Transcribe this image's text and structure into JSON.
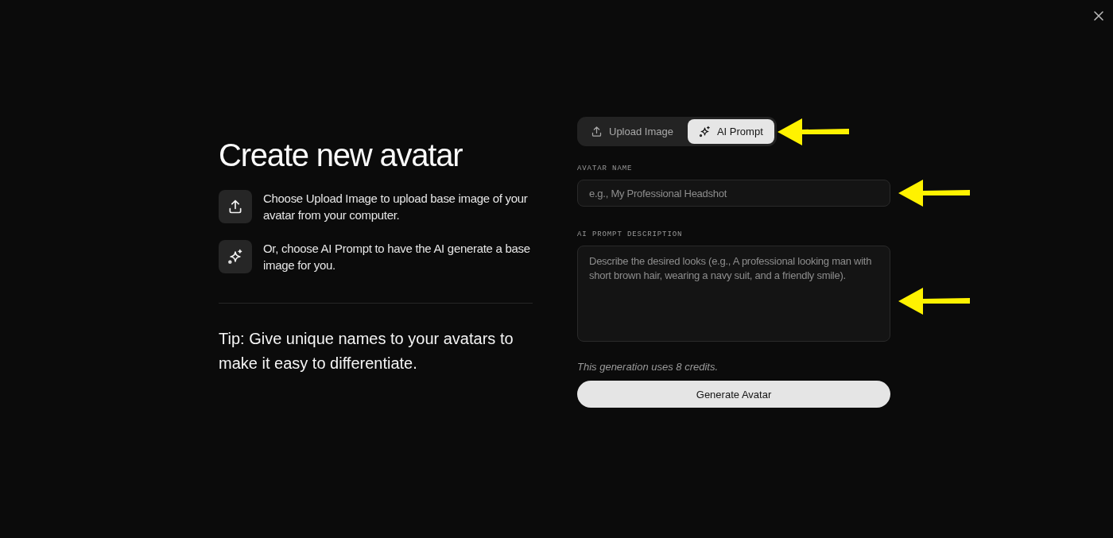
{
  "header": {
    "title": "Create new avatar"
  },
  "instructions": [
    {
      "kind": "upload",
      "text": "Choose Upload Image to upload base image of your avatar from your computer."
    },
    {
      "kind": "sparkle",
      "text": "Or, choose AI Prompt to have the AI generate a base image for you."
    }
  ],
  "tip": "Tip: Give unique names to your avatars to make it easy to differentiate.",
  "mode_tabs": {
    "tabs": [
      {
        "kind": "upload",
        "label": "Upload Image",
        "selected": false
      },
      {
        "kind": "sparkle",
        "label": "AI Prompt",
        "selected": true
      }
    ],
    "pointer_arrow": true
  },
  "avatar_name": {
    "label": "AVATAR NAME",
    "placeholder": "e.g., My Professional Headshot",
    "pointer_arrow": true
  },
  "prompt_description": {
    "label": "AI PROMPT DESCRIPTION",
    "placeholder": "Describe the desired looks (e.g., A professional looking man with short brown hair, wearing a navy suit, and a friendly smile).",
    "pointer_arrow": true
  },
  "credits_note": "This generation uses 8 credits.",
  "generate_button": {
    "label": "Generate Avatar"
  }
}
